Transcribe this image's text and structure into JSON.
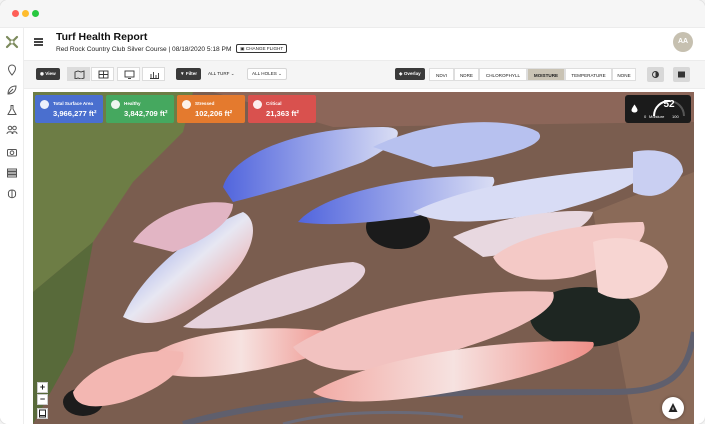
{
  "header": {
    "title": "Turf Health Report",
    "subtitle": "Red Rock Country Club Silver Course | 08/18/2020 5:18 PM",
    "change_flight_label": "CHANGE FLIGHT",
    "avatar_initials": "AA"
  },
  "toolbar": {
    "view_label": "View",
    "view_modes": [
      "map",
      "grid",
      "compare",
      "chart"
    ],
    "filter_label": "Filter",
    "turf_select": "ALL TURF",
    "holes_select": "ALL HOLES",
    "overlay_label": "Overlay",
    "layers": [
      "NDVI",
      "NDRE",
      "CHLOROPHYLL",
      "MOISTURE",
      "TEMPERATURE",
      "NONE"
    ],
    "active_layer": "MOISTURE"
  },
  "summary_cards": [
    {
      "label": "Total Surface Area",
      "value": "3,966,277 ft²",
      "color": "#4a6fcf",
      "icon": "area-icon"
    },
    {
      "label": "Healthy",
      "value": "3,842,709 ft²",
      "color": "#45a85f",
      "icon": "check-icon"
    },
    {
      "label": "Stressed",
      "value": "102,206 ft²",
      "color": "#e47a2e",
      "icon": "warning-icon"
    },
    {
      "label": "Critical",
      "value": "21,363 ft²",
      "color": "#d9514e",
      "icon": "x-icon"
    }
  ],
  "moisture_gauge": {
    "value": "52",
    "min": "0",
    "max": "100",
    "label": "Moisture",
    "fraction": 0.52
  },
  "map_controls": {
    "zoom_in": "+",
    "zoom_out": "−"
  },
  "colors": {
    "active_layer": "#c9c3b4",
    "wet": "#4a5fe0",
    "dry": "#f06b62"
  }
}
